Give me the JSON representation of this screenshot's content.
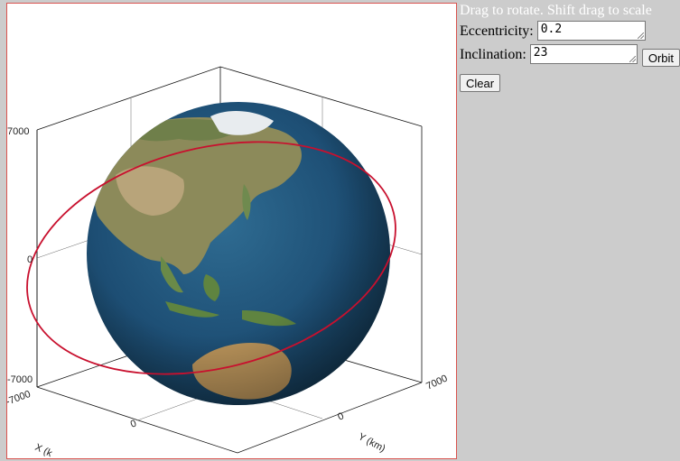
{
  "panel": {
    "instructions": "Drag to rotate. Shift drag to scale",
    "eccentricity_label": "Eccentricity:",
    "eccentricity_value": "0.2",
    "inclination_label": "Inclination:",
    "inclination_value": "23",
    "orbit_button": "Orbit",
    "clear_button": "Clear"
  },
  "plot": {
    "z_ticks": [
      "-7000",
      "0",
      "7000"
    ],
    "x_ticks": [
      "-7000",
      "0"
    ],
    "y_ticks": [
      "0",
      "7000"
    ],
    "x_label": "X (k",
    "y_label": "Y (km)"
  },
  "colors": {
    "orbit": "#c8102e",
    "ocean": "#1f4f73",
    "panel_bg": "#cccccc"
  },
  "icons": {
    "globe": "earth-globe-icon"
  }
}
